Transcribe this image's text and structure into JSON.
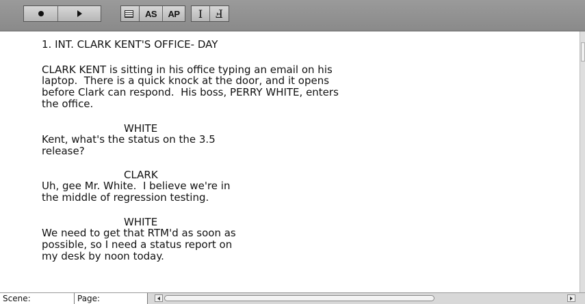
{
  "toolbar": {
    "record_icon": "record-icon",
    "play_icon": "play-icon",
    "list_icon": "list-icon",
    "as_label": "AS",
    "ap_label": "AP",
    "cursor_icon_1": "text-cursor-icon",
    "cursor_icon_2": "text-cursor-alt-icon"
  },
  "script": {
    "scene_heading": "1. INT. CLARK KENT'S OFFICE- DAY",
    "action": [
      "CLARK KENT is sitting in his office typing an email on his",
      "laptop.  There is a quick knock at the door, and it opens",
      "before Clark can respond.  His boss, PERRY WHITE, enters",
      "the office."
    ],
    "blocks": [
      {
        "character": "WHITE",
        "dialogue": [
          "Kent, what's the status on the 3.5",
          "release?"
        ]
      },
      {
        "character": "CLARK",
        "dialogue": [
          "Uh, gee Mr. White.  I believe we're in",
          "the middle of regression testing."
        ]
      },
      {
        "character": "WHITE",
        "dialogue": [
          "We need to get that RTM'd as soon as",
          "possible, so I need a status report on",
          "my desk by noon today."
        ]
      }
    ]
  },
  "status": {
    "scene_label": "Scene:",
    "page_label": "Page:"
  }
}
